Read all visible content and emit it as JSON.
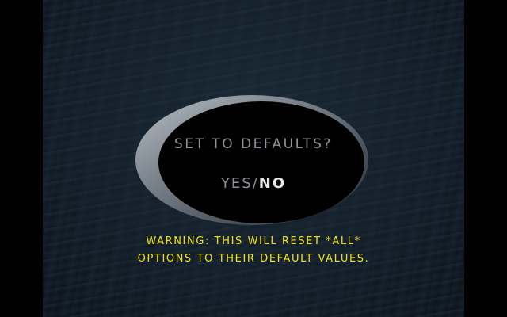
{
  "dialog": {
    "title": "SET TO DEFAULTS?",
    "yes_label": "YES",
    "separator": "/",
    "no_label": "NO",
    "selected": "NO"
  },
  "warning": {
    "line1": "WARNING: THIS WILL RESET *ALL*",
    "line2": "OPTIONS TO THEIR DEFAULT VALUES."
  },
  "colors": {
    "warning_text": "#f2e21a",
    "normal_text": "#8e939a",
    "selected_text": "#e6e8ea"
  }
}
